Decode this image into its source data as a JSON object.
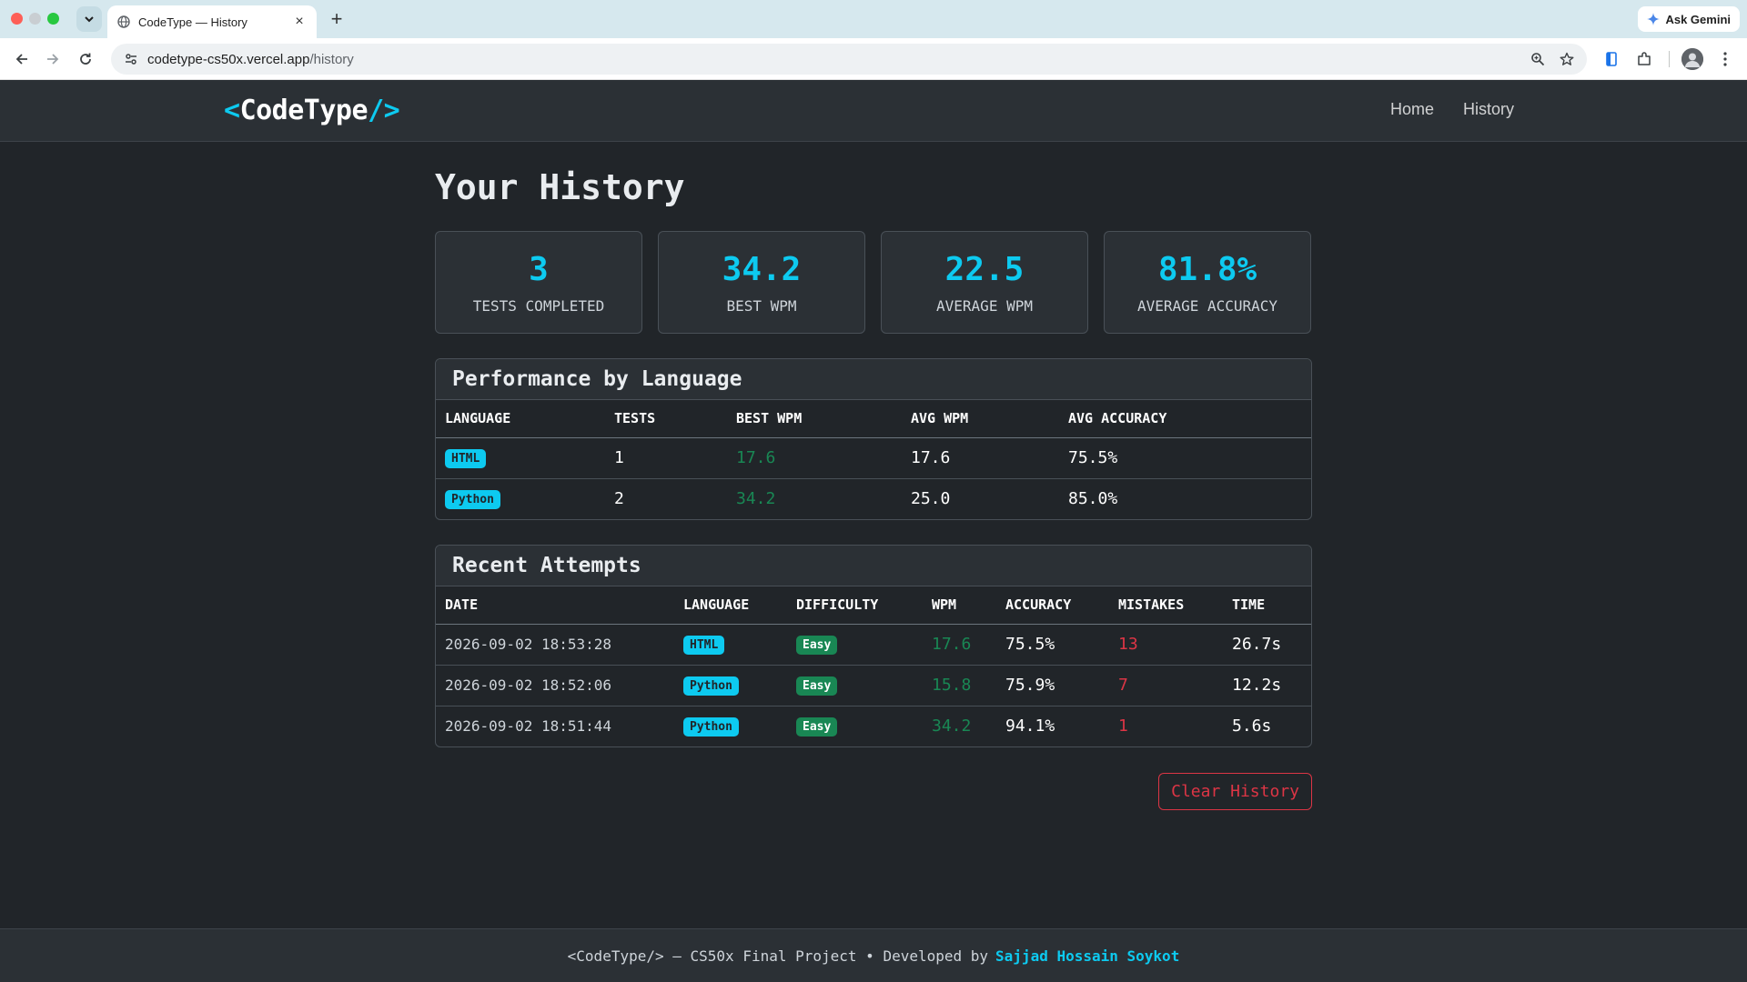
{
  "browser": {
    "tab_title": "CodeType — History",
    "url_host": "codetype-cs50x.vercel.app",
    "url_path": "/history",
    "gemini_label": "Ask Gemini"
  },
  "navbar": {
    "brand_open": "<",
    "brand_name": "CodeType",
    "brand_close": "/>",
    "links": [
      "Home",
      "History"
    ]
  },
  "page": {
    "title": "Your History"
  },
  "stats": [
    {
      "value": "3",
      "label": "TESTS COMPLETED"
    },
    {
      "value": "34.2",
      "label": "BEST WPM"
    },
    {
      "value": "22.5",
      "label": "AVERAGE WPM"
    },
    {
      "value": "81.8%",
      "label": "AVERAGE ACCURACY"
    }
  ],
  "performance": {
    "title": "Performance by Language",
    "headers": [
      "LANGUAGE",
      "TESTS",
      "BEST WPM",
      "AVG WPM",
      "AVG ACCURACY"
    ],
    "rows": [
      {
        "language": "HTML",
        "tests": "1",
        "best_wpm": "17.6",
        "avg_wpm": "17.6",
        "avg_accuracy": "75.5%"
      },
      {
        "language": "Python",
        "tests": "2",
        "best_wpm": "34.2",
        "avg_wpm": "25.0",
        "avg_accuracy": "85.0%"
      }
    ]
  },
  "recent": {
    "title": "Recent Attempts",
    "headers": [
      "DATE",
      "LANGUAGE",
      "DIFFICULTY",
      "WPM",
      "ACCURACY",
      "MISTAKES",
      "TIME"
    ],
    "rows": [
      {
        "date": "2026-09-02 18:53:28",
        "language": "HTML",
        "difficulty": "Easy",
        "wpm": "17.6",
        "accuracy": "75.5%",
        "mistakes": "13",
        "time": "26.7s"
      },
      {
        "date": "2026-09-02 18:52:06",
        "language": "Python",
        "difficulty": "Easy",
        "wpm": "15.8",
        "accuracy": "75.9%",
        "mistakes": "7",
        "time": "12.2s"
      },
      {
        "date": "2026-09-02 18:51:44",
        "language": "Python",
        "difficulty": "Easy",
        "wpm": "34.2",
        "accuracy": "94.1%",
        "mistakes": "1",
        "time": "5.6s"
      }
    ]
  },
  "actions": {
    "clear_label": "Clear History"
  },
  "footer": {
    "text": "<CodeType/> — CS50x Final Project • Developed by",
    "author": "Sajjad Hossain Soykot"
  },
  "colors": {
    "accent": "#0dcaf0",
    "success": "#198754",
    "danger": "#dc3545",
    "background": "#212529"
  }
}
